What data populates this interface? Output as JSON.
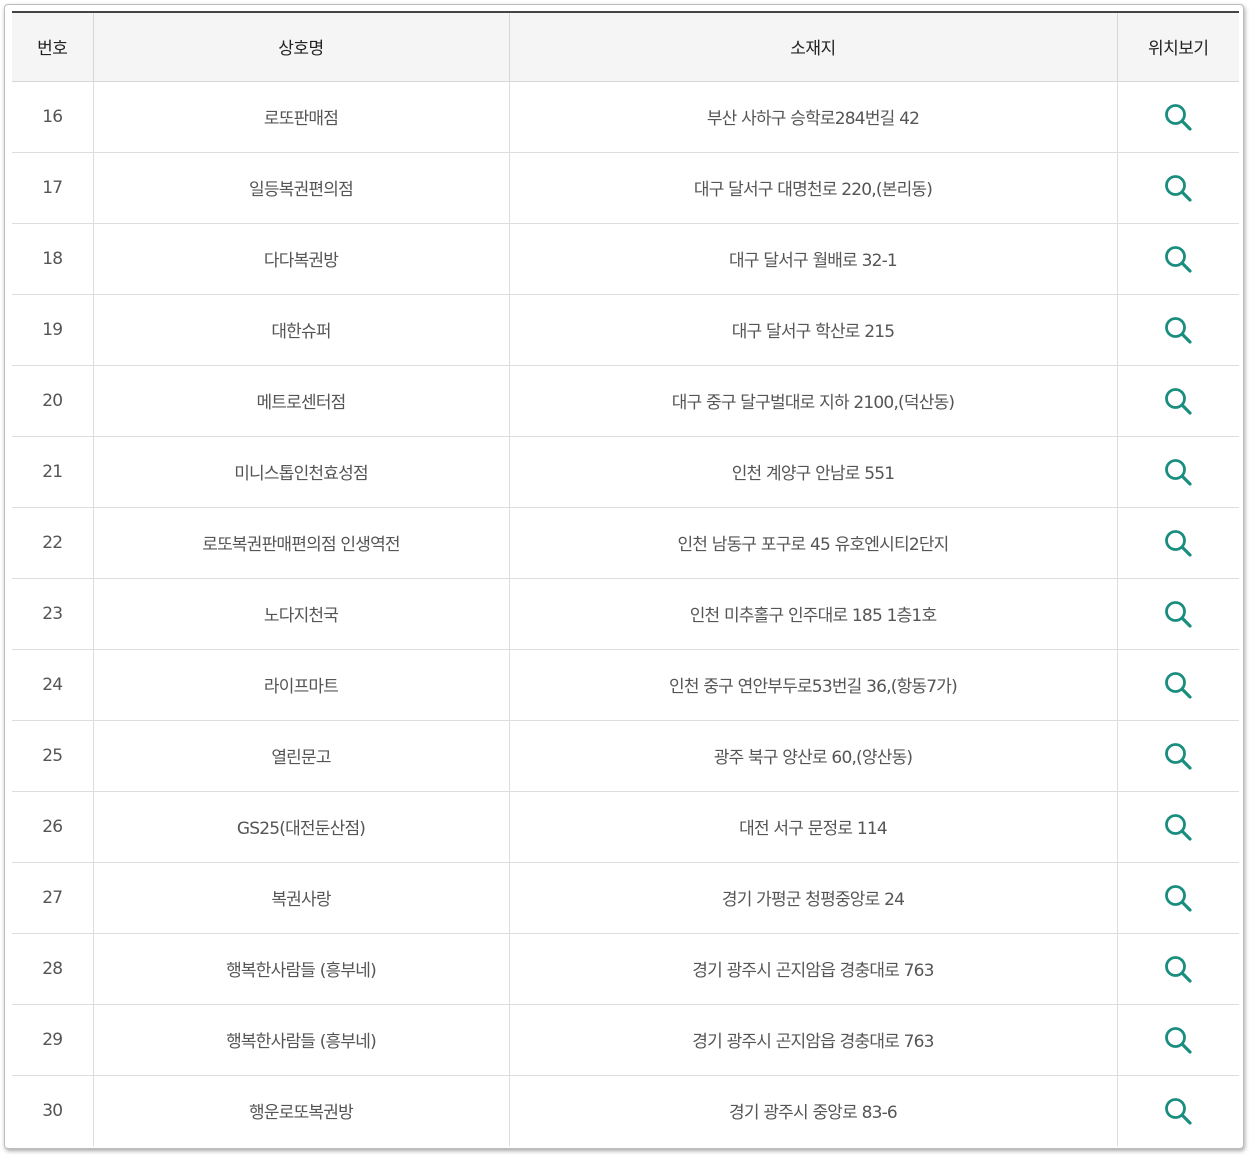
{
  "table": {
    "headers": {
      "number": "번호",
      "store_name": "상호명",
      "address": "소재지",
      "view_location": "위치보기"
    },
    "icon": "search-icon",
    "icon_color": "#1a8e7e",
    "rows": [
      {
        "number": "16",
        "store_name": "로또판매점",
        "address": "부산 사하구 승학로284번길 42"
      },
      {
        "number": "17",
        "store_name": "일등복권편의점",
        "address": "대구 달서구 대명천로 220,(본리동)"
      },
      {
        "number": "18",
        "store_name": "다다복권방",
        "address": "대구 달서구 월배로 32-1"
      },
      {
        "number": "19",
        "store_name": "대한슈퍼",
        "address": "대구 달서구 학산로 215"
      },
      {
        "number": "20",
        "store_name": "메트로센터점",
        "address": "대구 중구 달구벌대로 지하 2100,(덕산동)"
      },
      {
        "number": "21",
        "store_name": "미니스톱인천효성점",
        "address": "인천 계양구 안남로 551"
      },
      {
        "number": "22",
        "store_name": "로또복권판매편의점 인생역전",
        "address": "인천 남동구 포구로 45 유호엔시티2단지"
      },
      {
        "number": "23",
        "store_name": "노다지천국",
        "address": "인천 미추홀구 인주대로 185 1층1호"
      },
      {
        "number": "24",
        "store_name": "라이프마트",
        "address": "인천 중구 연안부두로53번길 36,(항동7가)"
      },
      {
        "number": "25",
        "store_name": "열린문고",
        "address": "광주 북구 양산로 60,(양산동)"
      },
      {
        "number": "26",
        "store_name": "GS25(대전둔산점)",
        "address": "대전 서구 문정로 114"
      },
      {
        "number": "27",
        "store_name": "복권사랑",
        "address": "경기 가평군 청평중앙로 24"
      },
      {
        "number": "28",
        "store_name": "행복한사람들 (흥부네)",
        "address": "경기 광주시 곤지암읍 경충대로 763"
      },
      {
        "number": "29",
        "store_name": "행복한사람들 (흥부네)",
        "address": "경기 광주시 곤지암읍 경충대로 763"
      },
      {
        "number": "30",
        "store_name": "행운로또복권방",
        "address": "경기 광주시 중앙로 83-6"
      }
    ]
  }
}
